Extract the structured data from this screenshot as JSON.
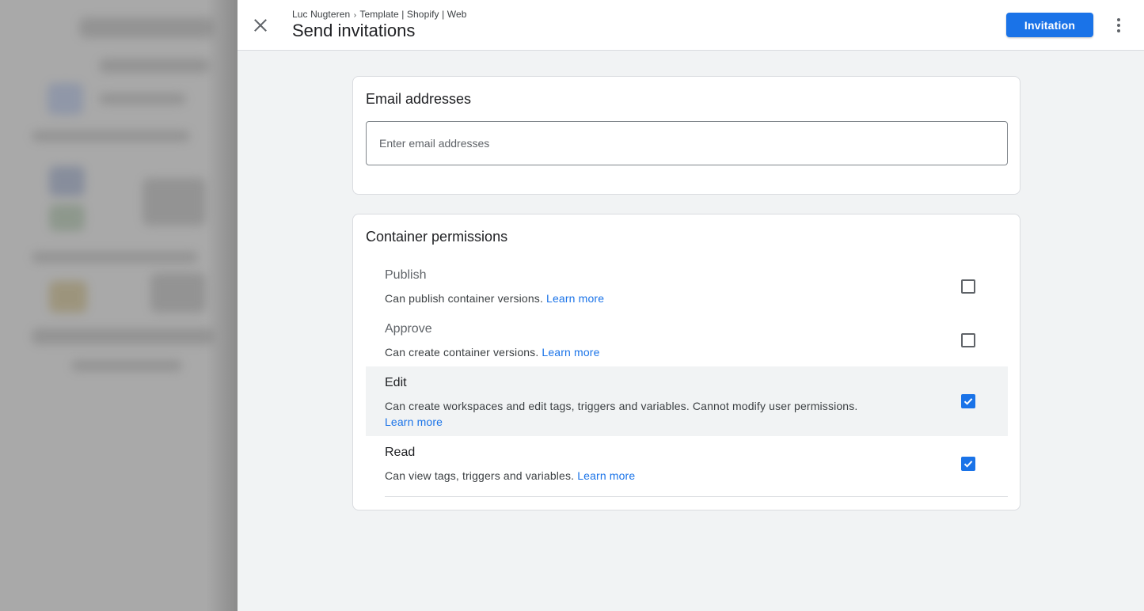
{
  "header": {
    "breadcrumb": {
      "account": "Luc Nugteren",
      "separator": "›",
      "container": "Template | Shopify | Web"
    },
    "title": "Send invitations",
    "primary_button": "Invitation",
    "icons": {
      "close": "close-icon",
      "more": "more-vert-icon"
    }
  },
  "email_card": {
    "title": "Email addresses",
    "input_value": "",
    "input_placeholder": "Enter email addresses"
  },
  "permissions_card": {
    "title": "Container permissions",
    "items": [
      {
        "name": "Publish",
        "description": "Can publish container versions.",
        "link": "Learn more",
        "checked": false,
        "disabled": true
      },
      {
        "name": "Approve",
        "description": "Can create container versions.",
        "link": "Learn more",
        "checked": false,
        "disabled": true
      },
      {
        "name": "Edit",
        "description": "Can create workspaces and edit tags, triggers and variables. Cannot modify user permissions.",
        "link": "Learn more",
        "checked": true,
        "disabled": false
      },
      {
        "name": "Read",
        "description": "Can view tags, triggers and variables.",
        "link": "Learn more",
        "checked": true,
        "disabled": false
      }
    ]
  },
  "colors": {
    "accent": "#1a73e8",
    "panel_background": "#f1f3f4",
    "text": "#202124",
    "secondary_text": "#5f6368"
  }
}
